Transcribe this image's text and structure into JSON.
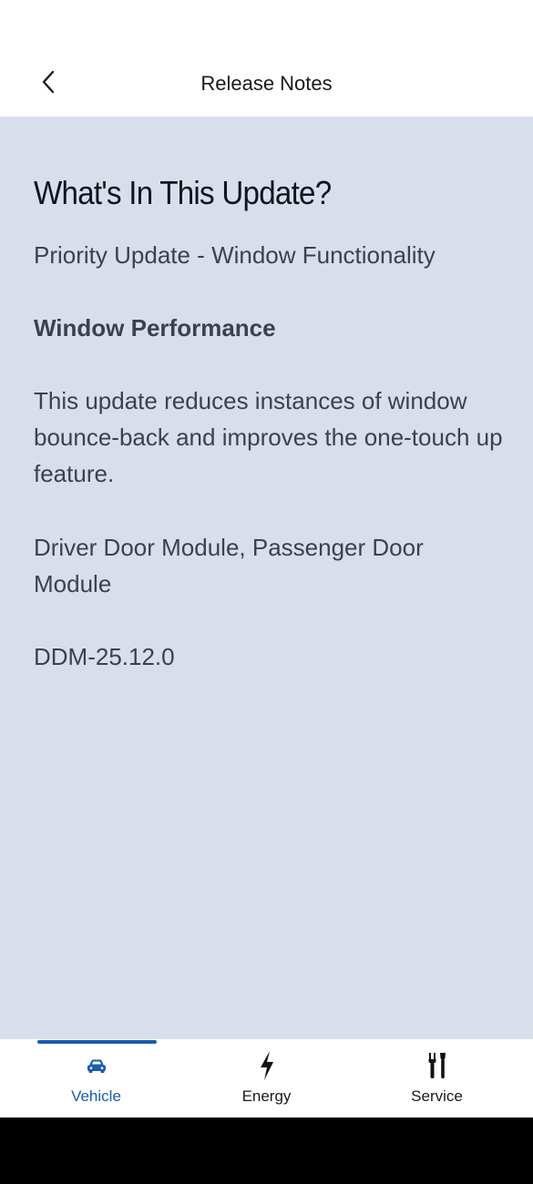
{
  "header": {
    "title": "Release Notes",
    "back_icon": "chevron-left-icon"
  },
  "content": {
    "heading": "What's In This Update?",
    "subtitle": "Priority Update - Window Functionality",
    "section_title": "Window Performance",
    "description": "This update reduces instances of window bounce-back and improves the one-touch up feature.",
    "modules": "Driver Door Module, Passenger Door Module",
    "version": "DDM-25.12.0"
  },
  "tabs": [
    {
      "label": "Vehicle",
      "icon": "car-icon",
      "selected": true
    },
    {
      "label": "Energy",
      "icon": "lightning-bolt-icon",
      "selected": false
    },
    {
      "label": "Service",
      "icon": "tools-icon",
      "selected": false
    }
  ],
  "colors": {
    "accent": "#1c5bb0",
    "content_background": "#d9dfea",
    "system_bar": "#000000"
  }
}
